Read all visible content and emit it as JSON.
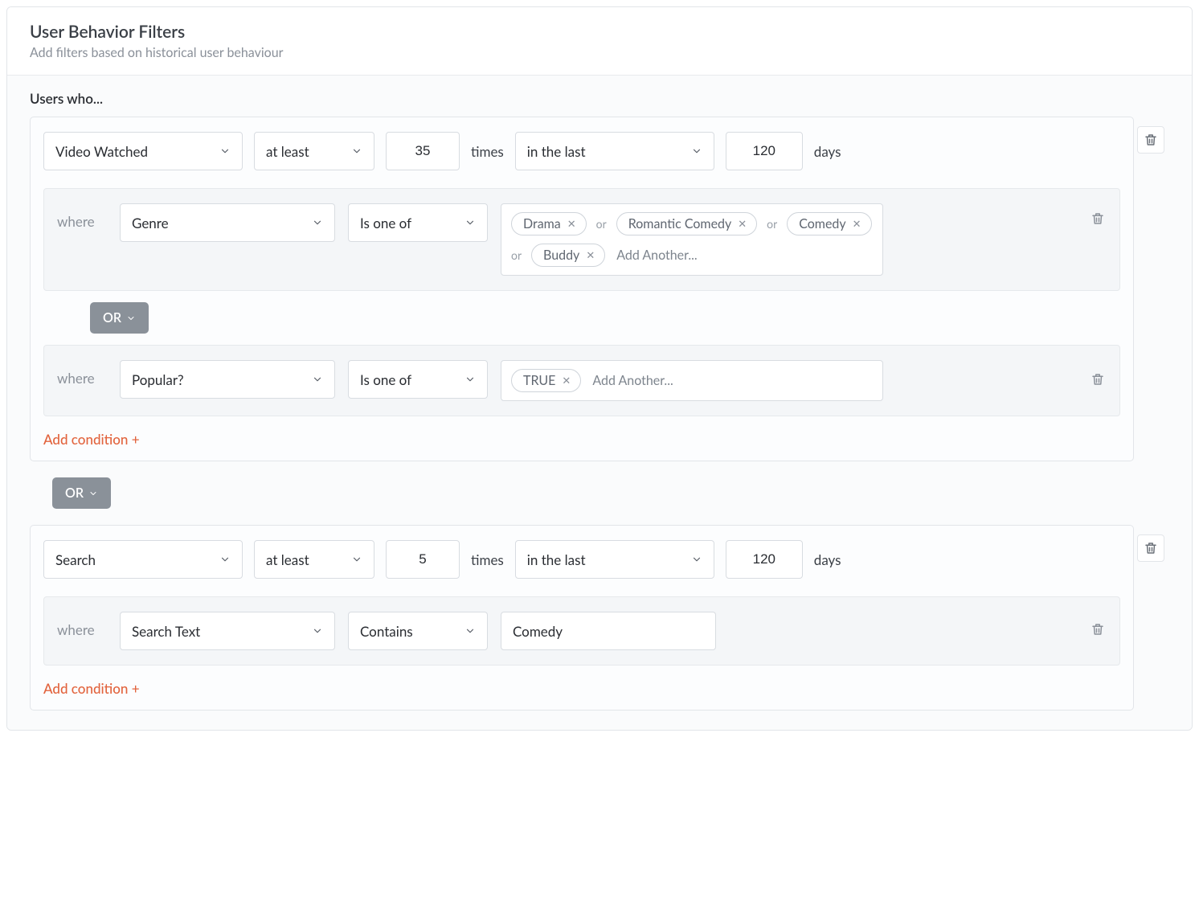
{
  "header": {
    "title": "User Behavior Filters",
    "subtitle": "Add filters based on historical user behaviour"
  },
  "leadLabel": "Users who...",
  "labels": {
    "times": "times",
    "days": "days",
    "where": "where",
    "orSep": "or",
    "addAnother": "Add Another...",
    "addCondition": "Add condition +",
    "orConnector": "OR"
  },
  "rules": [
    {
      "event": "Video Watched",
      "comparator": "at least",
      "count": "35",
      "rangeType": "in the last",
      "rangeValue": "120",
      "conditions": [
        {
          "property": "Genre",
          "operator": "Is one of",
          "valueType": "tags",
          "tags": [
            "Drama",
            "Romantic Comedy",
            "Comedy",
            "Buddy"
          ]
        },
        {
          "connector": "OR",
          "property": "Popular?",
          "operator": "Is one of",
          "valueType": "tags",
          "tags": [
            "TRUE"
          ]
        }
      ]
    },
    {
      "connector": "OR",
      "event": "Search",
      "comparator": "at least",
      "count": "5",
      "rangeType": "in the last",
      "rangeValue": "120",
      "conditions": [
        {
          "property": "Search Text",
          "operator": "Contains",
          "valueType": "text",
          "textValue": "Comedy"
        }
      ]
    }
  ]
}
